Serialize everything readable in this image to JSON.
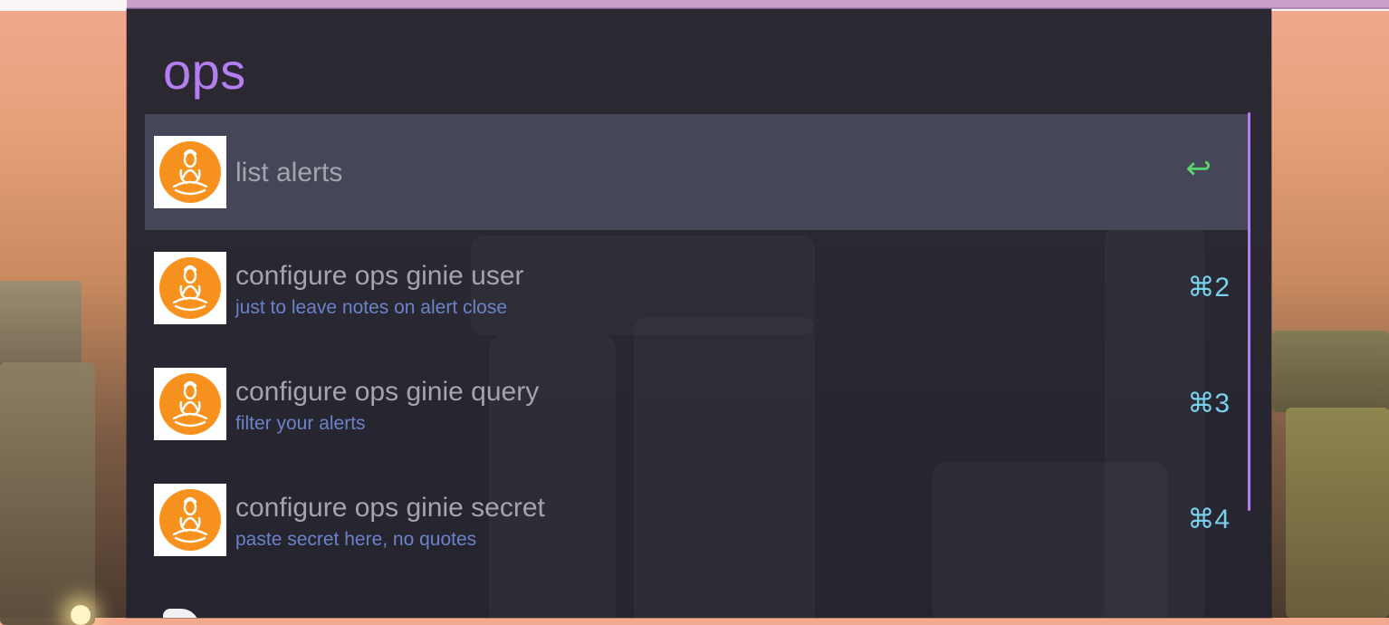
{
  "launcher": {
    "query": "ops",
    "results": [
      {
        "title": "list alerts",
        "subtitle": "",
        "shortcut": "↩",
        "selected": true,
        "icon": "ops-genie-logo-icon"
      },
      {
        "title": "configure ops ginie user",
        "subtitle": "just to leave notes on alert close",
        "shortcut": "⌘2",
        "selected": false,
        "icon": "ops-genie-logo-icon"
      },
      {
        "title": "configure ops ginie query",
        "subtitle": "filter your alerts",
        "shortcut": "⌘3",
        "selected": false,
        "icon": "ops-genie-logo-icon"
      },
      {
        "title": "configure ops ginie secret",
        "subtitle": "paste secret here, no quotes",
        "shortcut": "⌘4",
        "selected": false,
        "icon": "ops-genie-logo-icon"
      }
    ]
  },
  "colors": {
    "accent": "#b37ef0",
    "selected_row": "#454658",
    "panel_bg": "#242430",
    "shortcut": "#79d1ee",
    "enter_key": "#58d36e",
    "subtitle": "#6c82c8",
    "icon_orange": "#f7921e"
  }
}
